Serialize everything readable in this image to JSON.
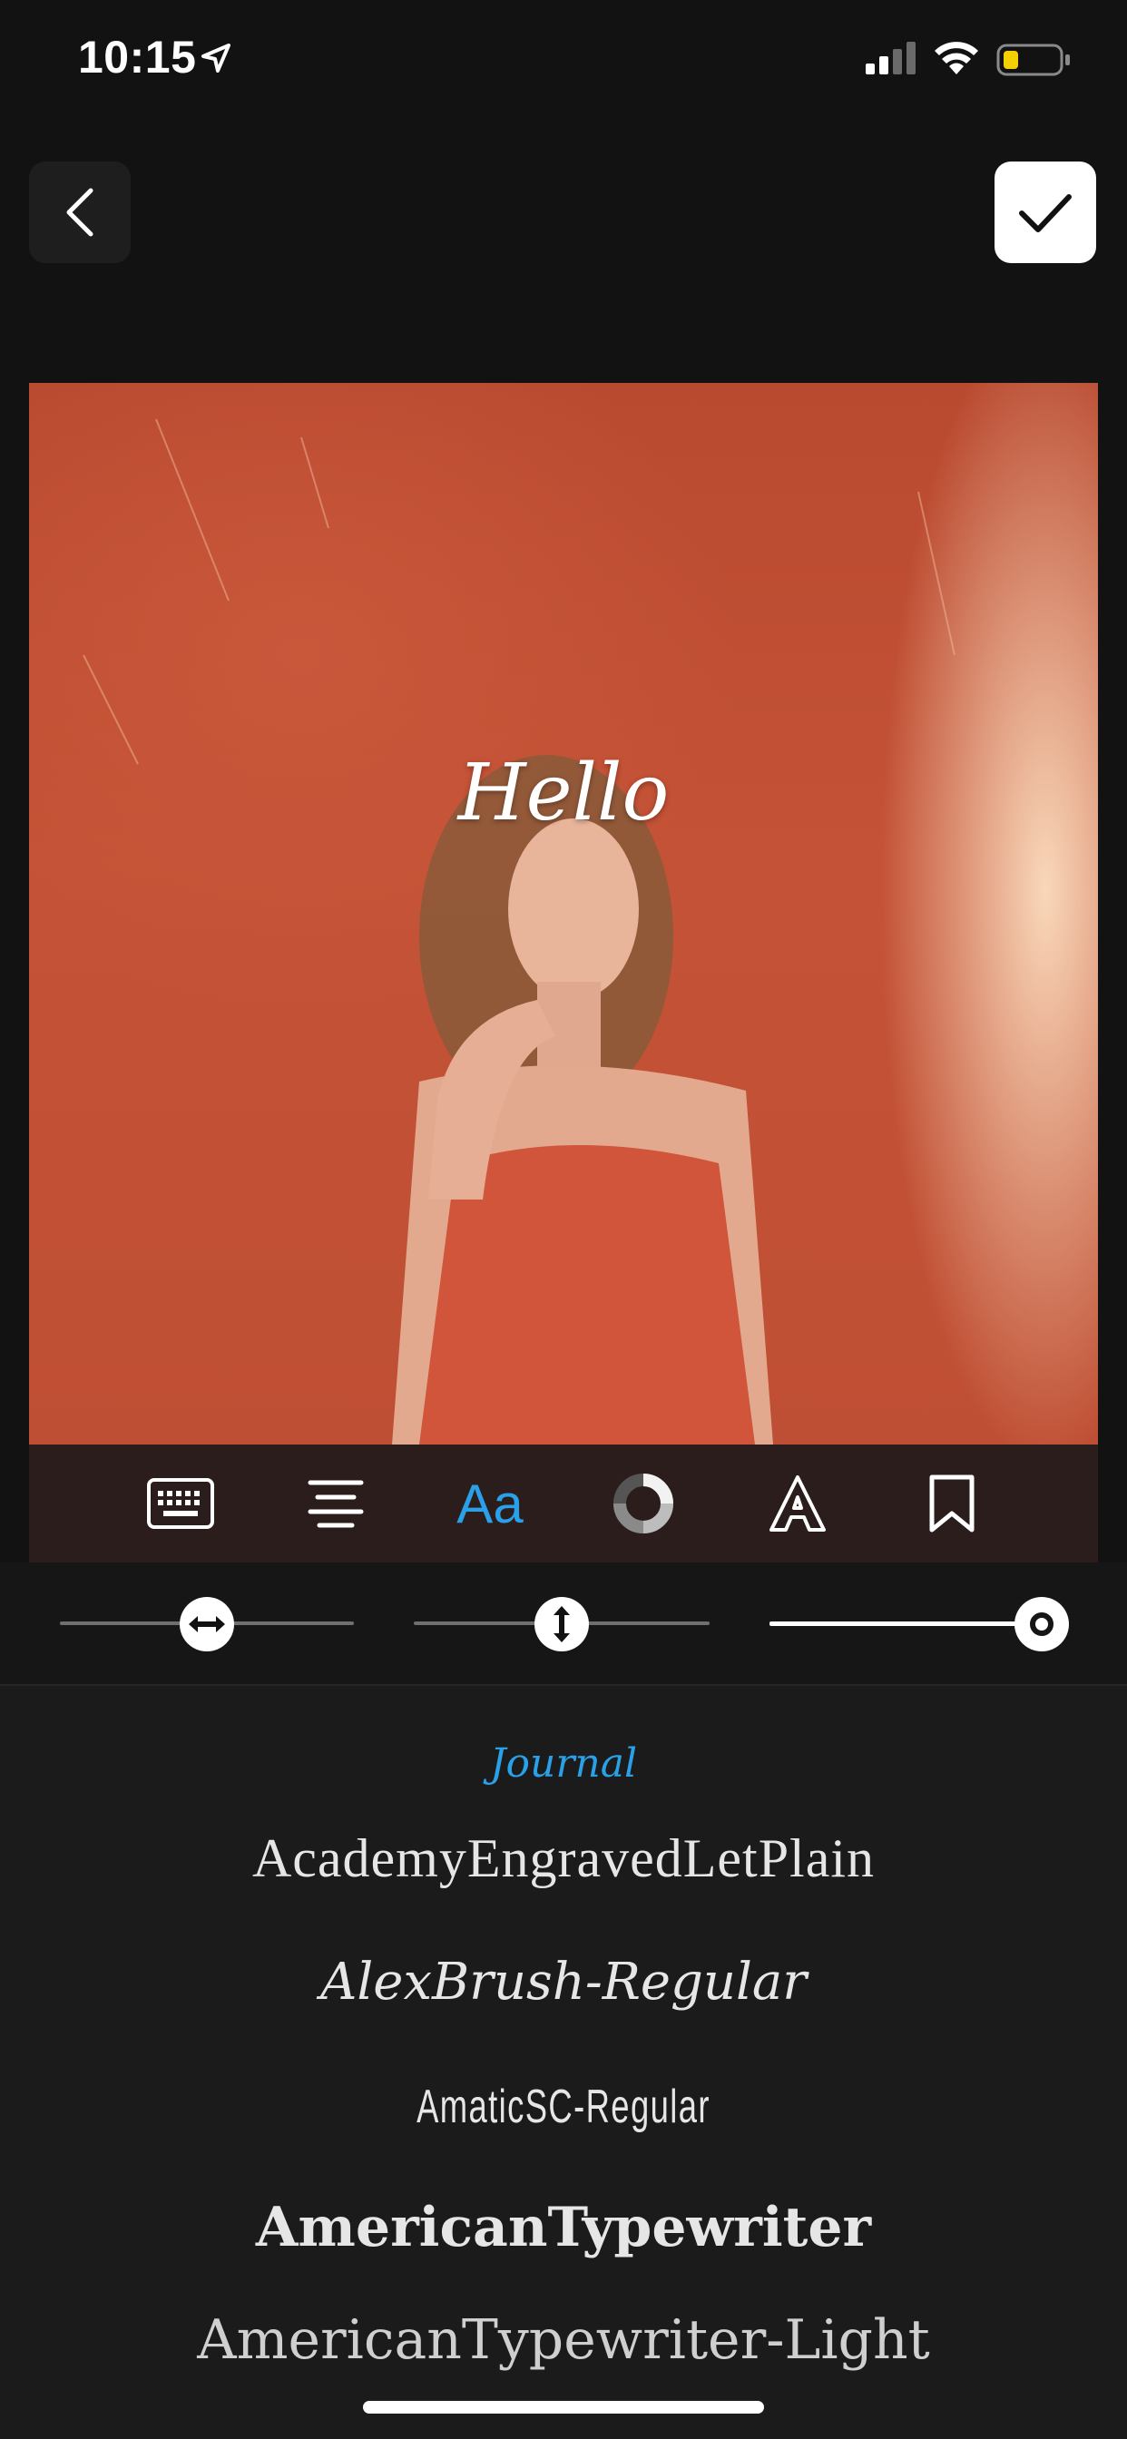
{
  "status_bar": {
    "time": "10:15",
    "battery_color": "#f5d000"
  },
  "canvas": {
    "overlay_text": "Hello"
  },
  "toolbar": {
    "tools": [
      "keyboard-icon",
      "align-center-icon",
      "font-icon",
      "color-ring-icon",
      "outline-letter-icon",
      "bookmark-icon"
    ],
    "font_tool_label": "Aa",
    "active_tool": "font",
    "accent_color": "#2aa0e8"
  },
  "sliders": {
    "letter_spacing": 0.5,
    "line_height": 0.5,
    "opacity": 1.0
  },
  "font_list": {
    "selected": "Journal",
    "items": [
      "Journal",
      "AcademyEngravedLetPlain",
      "AlexBrush-Regular",
      "AmaticSC-Regular",
      "AmericanTypewriter",
      "AmericanTypewriter-Light"
    ]
  }
}
